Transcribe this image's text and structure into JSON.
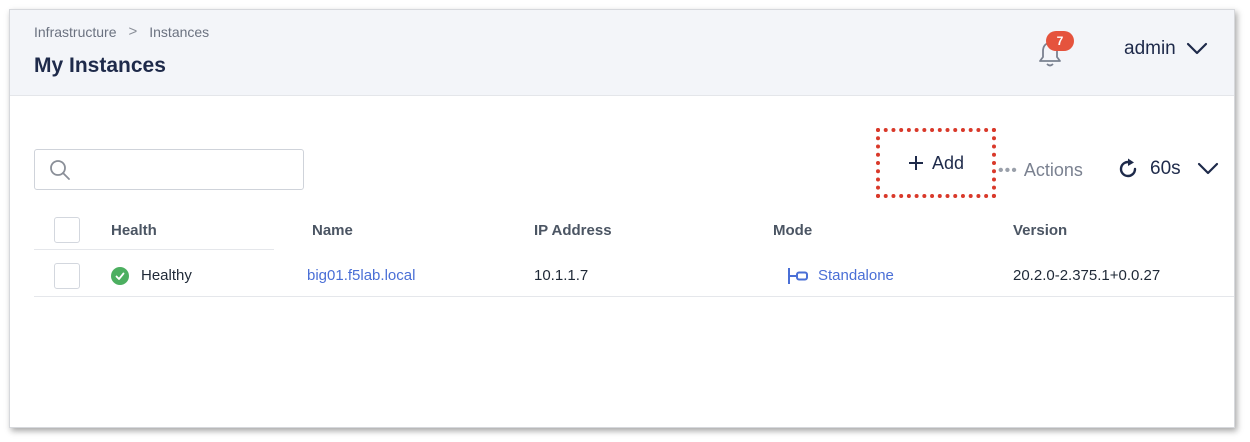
{
  "breadcrumb": {
    "items": [
      "Infrastructure",
      "Instances"
    ],
    "separator": ">"
  },
  "header": {
    "title": "My Instances",
    "notifications_count": "7",
    "user": "admin"
  },
  "toolbar": {
    "search_placeholder": "",
    "add_label": "Add",
    "actions_label": "Actions",
    "refresh_interval": "60s"
  },
  "table": {
    "columns": [
      "Health",
      "Name",
      "IP Address",
      "Mode",
      "Version"
    ],
    "rows": [
      {
        "health": "Healthy",
        "name": "big01.f5lab.local",
        "ip": "10.1.1.7",
        "mode": "Standalone",
        "version": "20.2.0-2.375.1+0.0.27"
      }
    ]
  },
  "colors": {
    "accent": "#4a6fd6",
    "title": "#1e2a4a",
    "badge": "#e5533d",
    "healthy": "#4caf60",
    "highlight": "#d9392a"
  }
}
